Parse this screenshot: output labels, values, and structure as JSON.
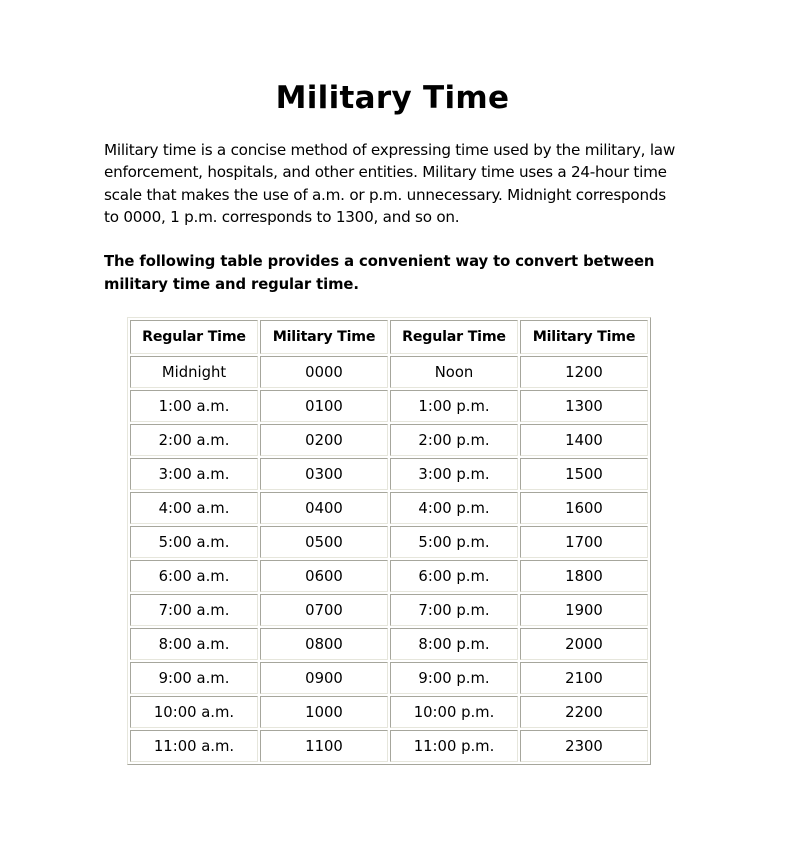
{
  "document": {
    "title": "Military Time",
    "intro": "Military time is a concise method of expressing time used by the military, law enforcement, hospitals, and other entities. Military time uses a 24-hour time scale that makes the use of a.m. or p.m. unnecessary. Midnight corresponds to 0000, 1 p.m. corresponds to 1300, and so on.",
    "lead": "The following table provides a convenient way to convert between military time and regular time."
  },
  "table": {
    "headers": [
      "Regular Time",
      "Military Time",
      "Regular Time",
      "Military Time"
    ],
    "rows": [
      [
        "Midnight",
        "0000",
        "Noon",
        "1200"
      ],
      [
        "1:00 a.m.",
        "0100",
        "1:00 p.m.",
        "1300"
      ],
      [
        "2:00 a.m.",
        "0200",
        "2:00 p.m.",
        "1400"
      ],
      [
        "3:00 a.m.",
        "0300",
        "3:00 p.m.",
        "1500"
      ],
      [
        "4:00 a.m.",
        "0400",
        "4:00 p.m.",
        "1600"
      ],
      [
        "5:00 a.m.",
        "0500",
        "5:00 p.m.",
        "1700"
      ],
      [
        "6:00 a.m.",
        "0600",
        "6:00 p.m.",
        "1800"
      ],
      [
        "7:00 a.m.",
        "0700",
        "7:00 p.m.",
        "1900"
      ],
      [
        "8:00 a.m.",
        "0800",
        "8:00 p.m.",
        "2000"
      ],
      [
        "9:00 a.m.",
        "0900",
        "9:00 p.m.",
        "2100"
      ],
      [
        "10:00 a.m.",
        "1000",
        "10:00 p.m.",
        "2200"
      ],
      [
        "11:00 a.m.",
        "1100",
        "11:00 p.m.",
        "2300"
      ]
    ]
  }
}
